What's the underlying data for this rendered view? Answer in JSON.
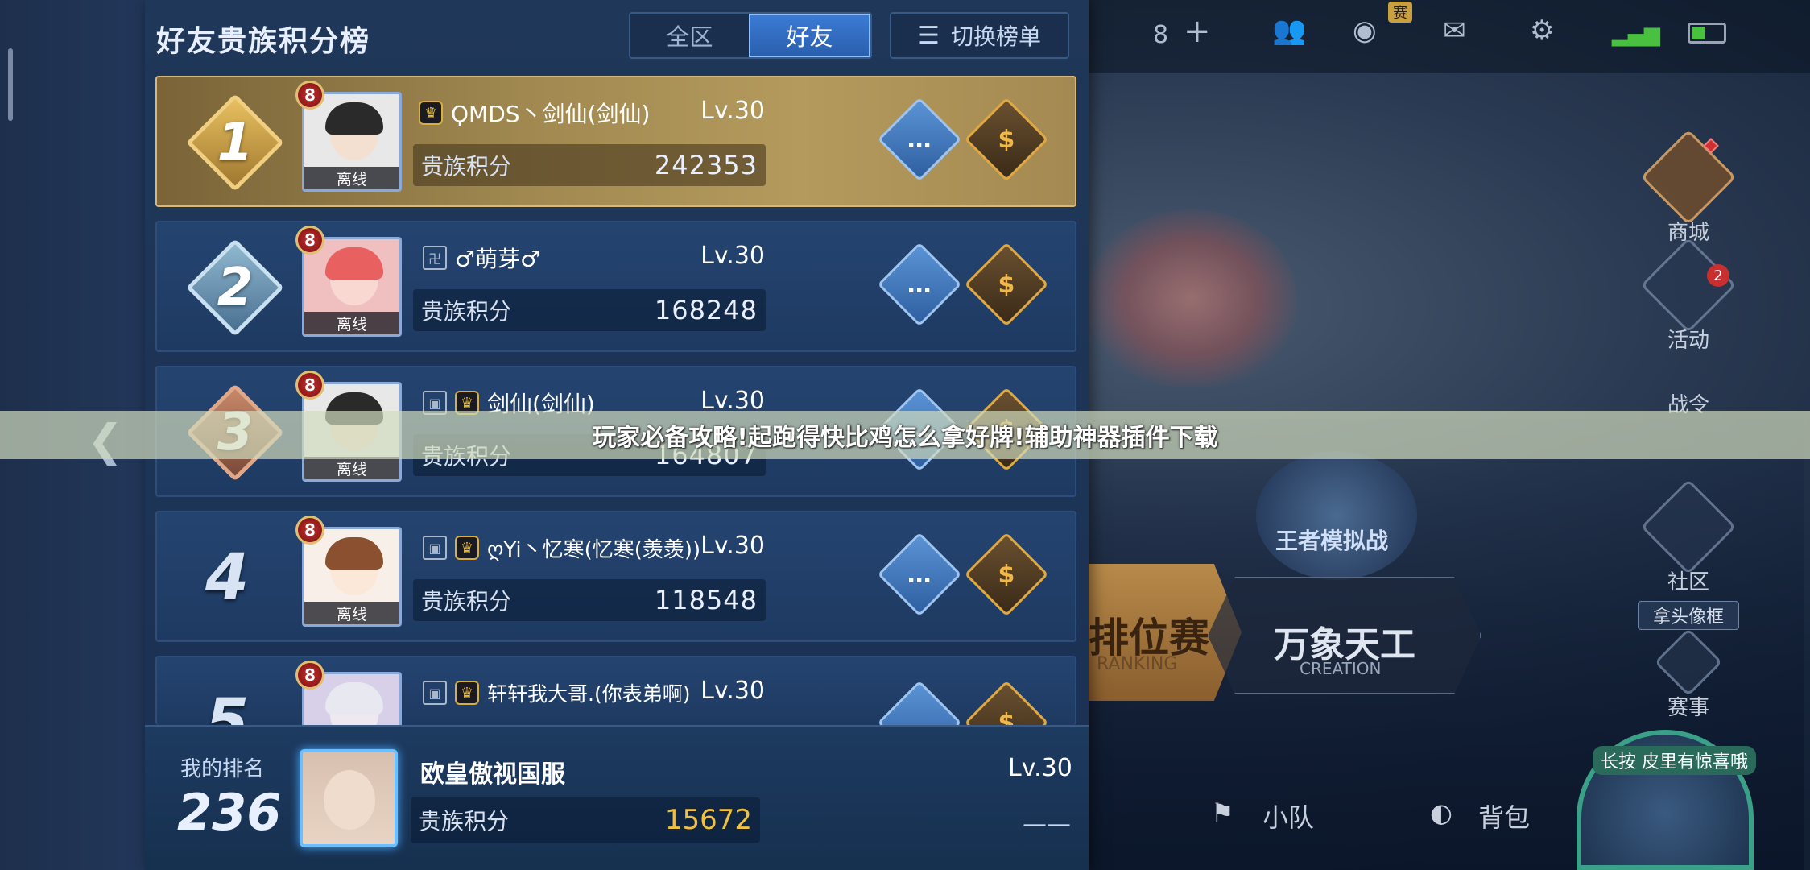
{
  "panel": {
    "title": "好友贵族积分榜",
    "tabs": [
      {
        "label": "全区",
        "active": false
      },
      {
        "label": "好友",
        "active": true
      }
    ],
    "switch_button": "切换榜单"
  },
  "entries": [
    {
      "rank": "1",
      "name": "ϘMDS丶剑仙(剑仙)",
      "level": "Lv.30",
      "score_label": "贵族积分",
      "score": "242353",
      "status": "离线",
      "vip_level": "8",
      "crown_icon": "crown-icon"
    },
    {
      "rank": "2",
      "name": "♂萌芽♂",
      "level": "Lv.30",
      "score_label": "贵族积分",
      "score": "168248",
      "status": "离线",
      "vip_level": "8",
      "prefix": "卍"
    },
    {
      "rank": "3",
      "name": "剑仙(剑仙)",
      "level": "Lv.30",
      "score_label": "贵族积分",
      "score": "164807",
      "status": "离线",
      "vip_level": "8"
    },
    {
      "rank": "4",
      "name": "ღYi丶忆寒(忆寒(羡羡))",
      "level": "Lv.30",
      "score_label": "贵族积分",
      "score": "118548",
      "status": "离线",
      "vip_level": "8"
    },
    {
      "rank": "5",
      "name": "轩轩我大哥.(你表弟啊)",
      "level": "Lv.30",
      "score_label": "贵族积分",
      "score": "",
      "status": "",
      "vip_level": "8"
    }
  ],
  "mine": {
    "label": "我的排名",
    "rank": "236",
    "name": "欧皇傲视国服",
    "level": "Lv.30",
    "score_label": "贵族积分",
    "score": "15672",
    "extra": "——"
  },
  "topbar": {
    "friend_count": "8",
    "plus": "+",
    "tag": "赛"
  },
  "side_menu": [
    "商城",
    "活动",
    "战令",
    "社区",
    "赛事"
  ],
  "side_badge": "2",
  "side_chip": "拿头像框",
  "center": {
    "ranked": "排位赛",
    "ranked_sub": "RANKING",
    "creation": "万象天工",
    "creation_sub": "CREATION",
    "simulator": "王者模拟战"
  },
  "bottom": {
    "team": "小队",
    "bag": "背包"
  },
  "hero_tag": "长按 皮里有惊喜哦",
  "banner": "玩家必备攻略!起跑得快比鸡怎么拿好牌!辅助神器插件下载",
  "colors": {
    "gold": "#d6b878",
    "accent_blue": "#3b7bd4",
    "score_gold": "#f0c040"
  }
}
